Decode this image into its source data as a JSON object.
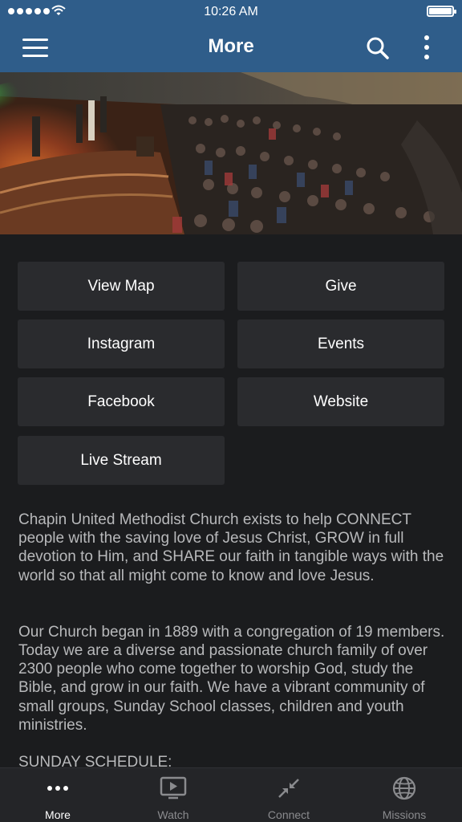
{
  "status_bar": {
    "time": "10:26 AM"
  },
  "nav": {
    "title": "More"
  },
  "buttons": [
    {
      "label": "View Map"
    },
    {
      "label": "Give"
    },
    {
      "label": "Instagram"
    },
    {
      "label": "Events"
    },
    {
      "label": "Facebook"
    },
    {
      "label": "Website"
    },
    {
      "label": "Live Stream"
    }
  ],
  "about": {
    "mission": "Chapin United Methodist Church exists to help CONNECT people with the saving love of Jesus Christ, GROW in full devotion to Him, and SHARE our faith in tangible ways with the world so that all might come to know and love Jesus.",
    "history": "Our Church began in 1889 with a congregation of 19 members. Today we are a diverse and passionate church family of over 2300 people who come together to worship God, study the Bible, and grow in our faith. We have a vibrant community of small groups, Sunday School classes, children and youth ministries.",
    "schedule_heading": "SUNDAY SCHEDULE:"
  },
  "tabs": [
    {
      "label": "More",
      "icon": "more-dots-icon",
      "active": true
    },
    {
      "label": "Watch",
      "icon": "play-screen-icon",
      "active": false
    },
    {
      "label": "Connect",
      "icon": "connect-arrows-icon",
      "active": false
    },
    {
      "label": "Missions",
      "icon": "globe-icon",
      "active": false
    }
  ],
  "colors": {
    "header": "#2f5d8a",
    "background": "#1b1c1e",
    "button": "#2a2b2e",
    "tabbar": "#242528"
  }
}
